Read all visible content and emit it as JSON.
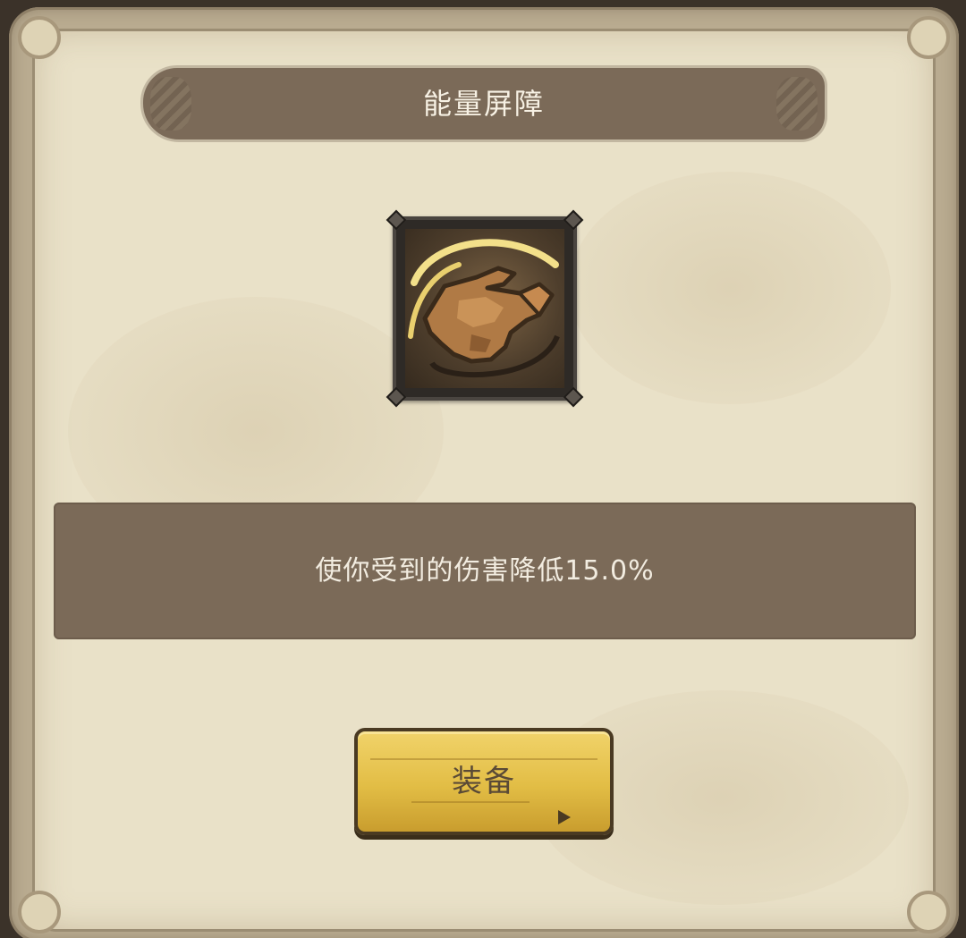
{
  "dialog": {
    "title": "能量屏障",
    "skill_icon": "grasping-hand-icon",
    "description": "使你受到的伤害降低15.0%",
    "equip_label": "装备"
  },
  "colors": {
    "parchment": "#e9e1c8",
    "banner": "#7b6a58",
    "button": "#e2bd45",
    "title_text": "#f7f1e4"
  }
}
